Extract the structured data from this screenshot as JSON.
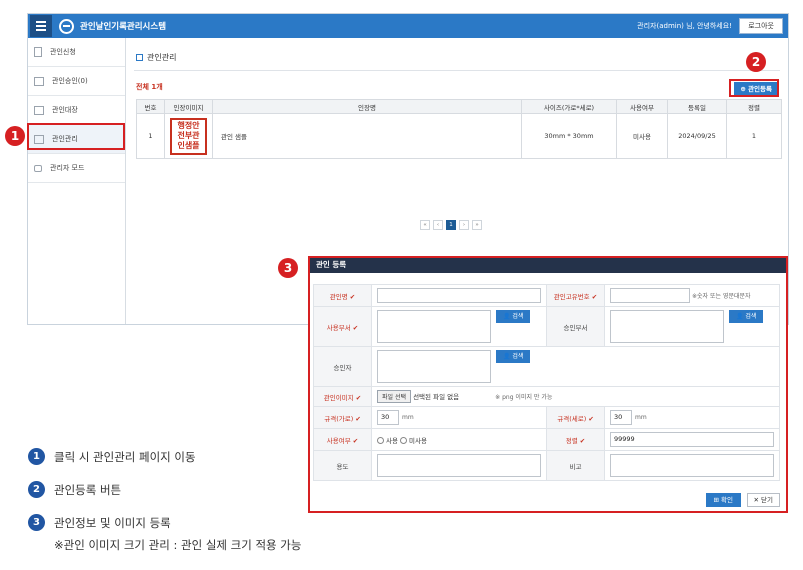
{
  "app": {
    "title": "관인날인기록관리시스템",
    "greeting": "관리자(admin) 님, 안녕하세요!",
    "logout": "로그아웃"
  },
  "sidebar": {
    "items": [
      {
        "label": "관인신청",
        "icon": "document-icon"
      },
      {
        "label": "관인승인(0)",
        "icon": "list-icon"
      },
      {
        "label": "관인대장",
        "icon": "ledger-icon"
      },
      {
        "label": "관인관리",
        "icon": "id-card-icon"
      },
      {
        "label": "관리자 모드",
        "icon": "lock-icon"
      }
    ]
  },
  "main": {
    "heading": "관인관리",
    "total": "전체 1개",
    "register_button": "관인등록",
    "columns": [
      "번호",
      "인장이미지",
      "인장명",
      "사이즈(가로*세로)",
      "사용여부",
      "등록일",
      "정렬"
    ],
    "rows": [
      {
        "no": "1",
        "seal_lines": [
          "행정안",
          "전부관",
          "인샘플"
        ],
        "name": "관인 샘플",
        "size": "30mm * 30mm",
        "use": "미사용",
        "date": "2024/09/25",
        "order": "1"
      }
    ],
    "pager": [
      "«",
      "‹",
      "1",
      "›",
      "»"
    ]
  },
  "callouts": [
    "1",
    "2",
    "3"
  ],
  "modal": {
    "title": "관인 등록",
    "name_label": "관인명",
    "code_label": "관인고유번호",
    "code_hint": "※숫자 또는 영문대문자",
    "dept_label": "사용부서",
    "approve_dept_label": "승인부서",
    "approver_label": "승인자",
    "search": "검색",
    "image_label": "관인이미지",
    "file_button": "파일 선택",
    "file_status": "선택된 파일 없음",
    "image_hint": "※ png 이미지 만 가능",
    "width_label": "규격(가로)",
    "width_value": "30",
    "height_label": "규격(세로)",
    "height_value": "30",
    "unit": "mm",
    "use_label": "사용여부",
    "use_yes": "사용",
    "use_no": "미사용",
    "order_label": "정렬",
    "order_value": "99999",
    "purpose_label": "용도",
    "note_label": "비고",
    "confirm": "확인",
    "close": "닫기"
  },
  "legend": [
    {
      "num": "1",
      "text": "클릭 시 관인관리 페이지 이동"
    },
    {
      "num": "2",
      "text": "관인등록 버튼"
    },
    {
      "num": "3",
      "text": "관인정보 및 이미지 등록"
    }
  ],
  "legend_note": "※관인 이미지 크기 관리 : 관인 실제 크기 적용 가능",
  "colors": {
    "primary": "#2b79c6",
    "highlight": "#d62022",
    "legend_badge": "#2156a3",
    "modal_header": "#24324a"
  }
}
